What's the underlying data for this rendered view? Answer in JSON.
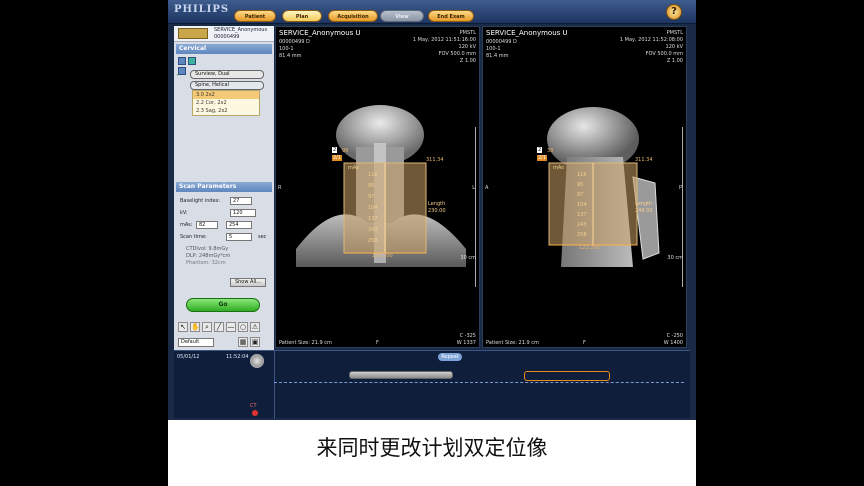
{
  "topbar": {
    "logo": "PHILIPS",
    "tabs": [
      {
        "label": "Patient",
        "state": "normal"
      },
      {
        "label": "Plan",
        "state": "active"
      },
      {
        "label": "Acquisition",
        "state": "normal"
      },
      {
        "label": "View",
        "state": "disabled"
      },
      {
        "label": "End Exam",
        "state": "normal"
      }
    ],
    "help_label": "?"
  },
  "patient": {
    "name": "SERVICE_Anonymous",
    "id": "00000499"
  },
  "protocol": {
    "title": "Cervical",
    "surview": "Surview, Dual",
    "helical": "Spine, Helical",
    "scan_items": [
      "3.0 2x2",
      "2.2 Cor, 2x2",
      "2.3 Sag, 2x2"
    ]
  },
  "scan_params": {
    "title": "Scan Parameters",
    "baselight_label": "Baselight index:",
    "baselight_value": "27",
    "kv_label": "kV:",
    "kv_value": "120",
    "mas_label": "mAs:",
    "mas_value": "82",
    "mas_value2": "254",
    "scan_time_label": "Scan time:",
    "scan_time_value": "5",
    "scan_time_unit": "sec",
    "ctdi": "CTDIvol: 9.8mGy",
    "dlp": "DLP:        248mGy*cm",
    "phantom": "Phantom: 32cm",
    "show_all": "Show All...",
    "go": "Go",
    "default_select": "Default"
  },
  "viewer_left": {
    "name": "SERVICE_Anonymous U",
    "pid": "00000499 D",
    "series": "100-1",
    "mm": "81.4 mm",
    "org": "PMSTL",
    "date": "1 May, 2012 11:51:16:00",
    "kv": "120 kV",
    "fov": "FOV 500.0 mm",
    "zoom": "Z 1.00",
    "orient_left": "R",
    "orient_right": "L",
    "plan_num": "2",
    "plan_label": "2/1",
    "pos1": "98",
    "pos2": "311.34",
    "mas_label": "mAs",
    "mas_values": [
      "116",
      "95",
      "97",
      "104",
      "137",
      "243",
      "258"
    ],
    "length_label": "Length",
    "length_value": "230.00",
    "bottom_value": "150.200",
    "scale": "30 cm",
    "c": "C   -325",
    "w": "W  1337",
    "patient_size": "Patient Size: 21.9 cm",
    "foot": "F"
  },
  "viewer_right": {
    "name": "SERVICE_Anonymous U",
    "pid": "00000499 D",
    "series": "100-1",
    "mm": "81.4 mm",
    "org": "PMSTL",
    "date": "1 May, 2012 11:52:08:00",
    "kv": "120 kV",
    "fov": "FOV 500.0 mm",
    "zoom": "Z 1.00",
    "orient_left": "A",
    "orient_right": "P",
    "plan_num": "2",
    "plan_label": "2/1",
    "pos1": "38",
    "pos2": "311.34",
    "mas_label": "mAs",
    "mas_values": [
      "116",
      "95",
      "97",
      "104",
      "137",
      "243",
      "258"
    ],
    "length_label": "Length",
    "length_value": "248.00",
    "bottom_value": "122.200",
    "scale": "30 cm",
    "c": "C   -250",
    "w": "W  1400",
    "patient_size": "Patient Size: 21.9 cm",
    "foot": "F"
  },
  "timeline": {
    "date": "05/01/12",
    "time": "11:52:04",
    "badge": "Repeat",
    "ct_label": "CT"
  },
  "caption": "来同时更改计划双定位像",
  "colors": {
    "plan_box": "#c9a064",
    "app_bg": "#1b2a44",
    "go_green": "#2fae23"
  }
}
